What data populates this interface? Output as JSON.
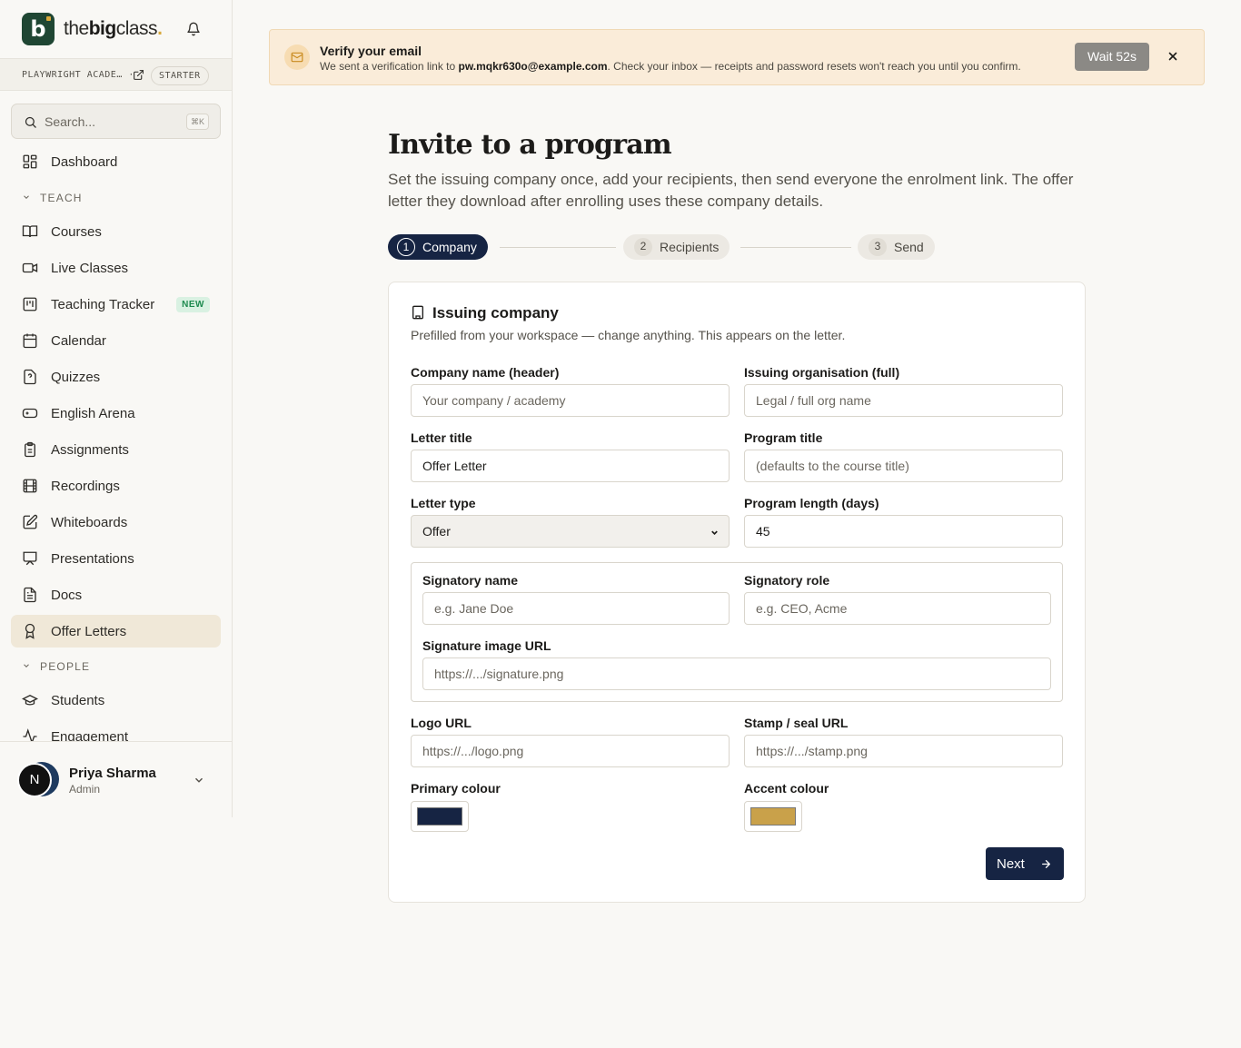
{
  "brand": {
    "logo_letter": "b",
    "name_pre": "the",
    "name_bold": "big",
    "name_post": "class",
    "name_dot": "."
  },
  "workspace": {
    "name": "PLAYWRIGHT ACADE…",
    "separator": "·",
    "plan": "STARTER"
  },
  "search": {
    "placeholder": "Search...",
    "shortcut": "⌘K"
  },
  "nav": {
    "dashboard": "Dashboard",
    "section_teach": "TEACH",
    "courses": "Courses",
    "live_classes": "Live Classes",
    "teaching_tracker": "Teaching Tracker",
    "teaching_tracker_badge": "NEW",
    "calendar": "Calendar",
    "quizzes": "Quizzes",
    "english_arena": "English Arena",
    "assignments": "Assignments",
    "recordings": "Recordings",
    "whiteboards": "Whiteboards",
    "presentations": "Presentations",
    "docs": "Docs",
    "offer_letters": "Offer Letters",
    "section_people": "PEOPLE",
    "students": "Students",
    "engagement": "Engagement"
  },
  "user": {
    "initial": "N",
    "name": "Priya Sharma",
    "role": "Admin"
  },
  "banner": {
    "title": "Verify your email",
    "text_pre": "We sent a verification link to ",
    "email": "pw.mqkr630o@example.com",
    "text_post": ". Check your inbox — receipts and password resets won't reach you until you confirm.",
    "wait_label": "Wait 52s"
  },
  "page": {
    "title": "Invite to a program",
    "subtitle": "Set the issuing company once, add your recipients, then send everyone the enrolment link. The offer letter they download after enrolling uses these company details."
  },
  "steps": [
    {
      "num": "1",
      "label": "Company",
      "active": true
    },
    {
      "num": "2",
      "label": "Recipients",
      "active": false
    },
    {
      "num": "3",
      "label": "Send",
      "active": false
    }
  ],
  "card": {
    "title": "Issuing company",
    "subtitle": "Prefilled from your workspace — change anything. This appears on the letter.",
    "fields": {
      "company_name": {
        "label": "Company name (header)",
        "value": "",
        "placeholder": "Your company / academy"
      },
      "issuing_org": {
        "label": "Issuing organisation (full)",
        "value": "",
        "placeholder": "Legal / full org name"
      },
      "letter_title": {
        "label": "Letter title",
        "value": "Offer Letter",
        "placeholder": ""
      },
      "program_title": {
        "label": "Program title",
        "value": "",
        "placeholder": "(defaults to the course title)"
      },
      "letter_type": {
        "label": "Letter type",
        "value": "Offer"
      },
      "program_length": {
        "label": "Program length (days)",
        "value": "45"
      },
      "signatory_name": {
        "label": "Signatory name",
        "value": "",
        "placeholder": "e.g. Jane Doe"
      },
      "signatory_role": {
        "label": "Signatory role",
        "value": "",
        "placeholder": "e.g. CEO, Acme"
      },
      "signature_url": {
        "label": "Signature image URL",
        "value": "",
        "placeholder": "https://.../signature.png"
      },
      "logo_url": {
        "label": "Logo URL",
        "value": "",
        "placeholder": "https://.../logo.png"
      },
      "stamp_url": {
        "label": "Stamp / seal URL",
        "value": "",
        "placeholder": "https://.../stamp.png"
      },
      "primary_colour": {
        "label": "Primary colour",
        "value": "#162443"
      },
      "accent_colour": {
        "label": "Accent colour",
        "value": "#c9a14a"
      }
    },
    "next_label": "Next"
  },
  "icons": {
    "bell": "bell-icon",
    "external": "external-link-icon",
    "search": "search-icon",
    "mail": "mail-icon",
    "close": "close-icon",
    "building": "building-icon",
    "arrow": "arrow-right-icon"
  }
}
